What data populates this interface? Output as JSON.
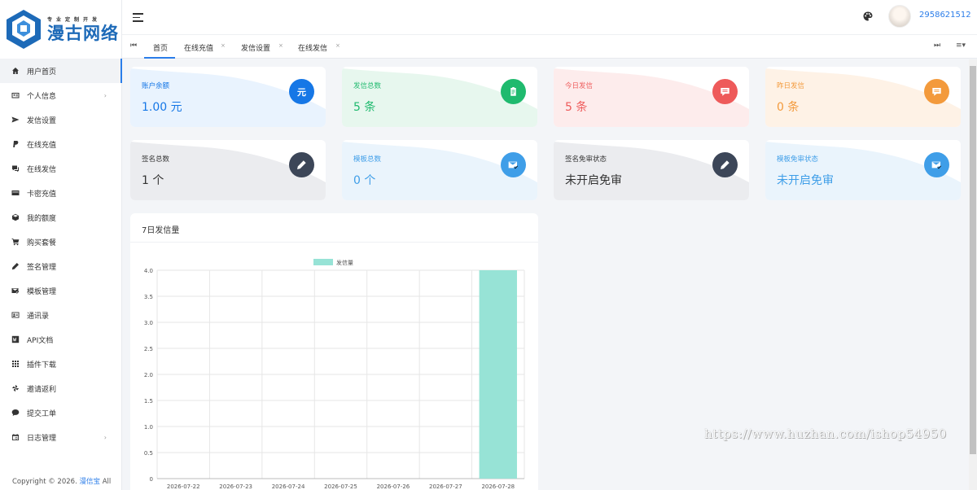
{
  "brand": {
    "slogan": "专业定制开发",
    "name": "漫古网络"
  },
  "sidebar": {
    "items": [
      {
        "label": "用户首页",
        "icon": "home-icon",
        "active": true,
        "has_children": false
      },
      {
        "label": "个人信息",
        "icon": "id-card-icon",
        "has_children": true
      },
      {
        "label": "发信设置",
        "icon": "send-icon",
        "has_children": false
      },
      {
        "label": "在线充值",
        "icon": "paypal-icon",
        "has_children": false
      },
      {
        "label": "在线发信",
        "icon": "message-icon",
        "has_children": false
      },
      {
        "label": "卡密充值",
        "icon": "card-icon",
        "has_children": false
      },
      {
        "label": "我的额度",
        "icon": "cube-icon",
        "has_children": false
      },
      {
        "label": "购买套餐",
        "icon": "cart-icon",
        "has_children": false
      },
      {
        "label": "签名管理",
        "icon": "pen-icon",
        "has_children": false
      },
      {
        "label": "模板管理",
        "icon": "mail-check-icon",
        "has_children": false
      },
      {
        "label": "通讯录",
        "icon": "contacts-icon",
        "has_children": false
      },
      {
        "label": "API文档",
        "icon": "word-icon",
        "has_children": false
      },
      {
        "label": "插件下载",
        "icon": "grid-icon",
        "has_children": false
      },
      {
        "label": "邀请返利",
        "icon": "pinwheel-icon",
        "has_children": false
      },
      {
        "label": "提交工单",
        "icon": "chat-icon",
        "has_children": false
      },
      {
        "label": "日志管理",
        "icon": "calendar-icon",
        "has_children": true
      }
    ],
    "copyright_prefix": "Copyright © 2026.",
    "copyright_brand": "漫信宝",
    "copyright_suffix": "All"
  },
  "header": {
    "username": "2958621512"
  },
  "tabs": [
    {
      "label": "首页",
      "closable": false,
      "active": true
    },
    {
      "label": "在线充值",
      "closable": true
    },
    {
      "label": "发信设置",
      "closable": true
    },
    {
      "label": "在线发信",
      "closable": true
    }
  ],
  "cards": [
    {
      "label": "账户余额",
      "value": "1.00 元",
      "icon": "yuan-icon",
      "icon_text": "元",
      "color": "#1677e6",
      "bg": "#e9f3fe"
    },
    {
      "label": "发信总数",
      "value": "5 条",
      "icon": "clipboard-icon",
      "color": "#1fba6e",
      "bg": "#e7f7ee"
    },
    {
      "label": "今日发信",
      "value": "5 条",
      "icon": "comment-icon",
      "color": "#ee5a5a",
      "bg": "#fdecec"
    },
    {
      "label": "昨日发信",
      "value": "0 条",
      "icon": "comment-icon",
      "color": "#f39a3c",
      "bg": "#fef2e6"
    },
    {
      "label": "签名总数",
      "value": "1 个",
      "icon": "pen-icon",
      "color": "#3c4658",
      "bg": "#ebecef",
      "text_color": "#333"
    },
    {
      "label": "模板总数",
      "value": "0 个",
      "icon": "mail-check-icon",
      "color": "#3f9ee8",
      "bg": "#eaf4fc"
    },
    {
      "label": "签名免审状态",
      "value": "未开启免审",
      "icon": "pen-icon",
      "color": "#3c4658",
      "bg": "#ebecef",
      "text_color": "#333"
    },
    {
      "label": "模板免审状态",
      "value": "未开启免审",
      "icon": "mail-check-icon",
      "color": "#3f9ee8",
      "bg": "#eaf4fc"
    }
  ],
  "chart_panel": {
    "title": "7日发信量"
  },
  "chart_data": {
    "type": "bar",
    "categories": [
      "2026-07-22",
      "2026-07-23",
      "2026-07-24",
      "2026-07-25",
      "2026-07-26",
      "2026-07-27",
      "2026-07-28"
    ],
    "series": [
      {
        "name": "发信量",
        "values": [
          0,
          0,
          0,
          0,
          0,
          0,
          4
        ],
        "color": "#97e3d6"
      }
    ],
    "ylim": [
      0,
      4
    ],
    "yticks": [
      "0",
      "0.5",
      "1.0",
      "1.5",
      "2.0",
      "2.5",
      "3.0",
      "3.5",
      "4.0"
    ],
    "legend": "top-center",
    "grid": true
  },
  "watermark": "https://www.huzhan.com/ishop54950"
}
